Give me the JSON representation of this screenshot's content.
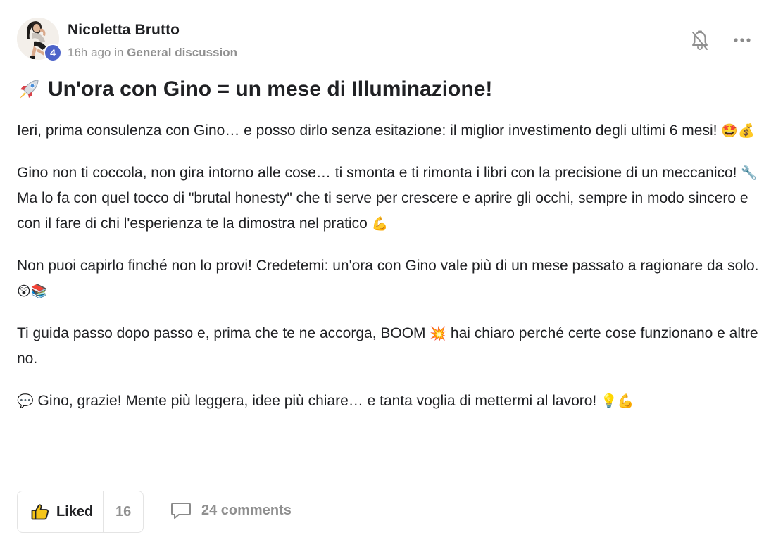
{
  "author": {
    "name": "Nicoletta Brutto",
    "level": "4",
    "time": "16h ago",
    "in_label": "in",
    "category": "General discussion"
  },
  "post": {
    "title_emoji": "rocket",
    "title": "Un'ora con Gino = un mese di Illuminazione!",
    "paragraphs": [
      {
        "text": "Ieri, prima consulenza con Gino… e posso dirlo senza esitazione: il miglior investimento degli ultimi 6 mesi!",
        "emoji": "🤩💰"
      },
      {
        "text": "Gino non ti coccola, non gira intorno alle cose… ti smonta e ti rimonta i libri con la precisione di un meccanico!",
        "emoji": "🔧"
      },
      {
        "text": "Ma lo fa con quel tocco di \"brutal honesty\" che ti serve per crescere e aprire gli occhi, sempre in modo sincero e con il fare di chi l'esperienza te la dimostra nel pratico",
        "emoji": "💪"
      },
      {
        "text": "Non puoi capirlo finché non lo provi! Credetemi: un'ora con Gino vale più di un mese passato a ragionare da solo.",
        "emoji": "😲📚"
      },
      {
        "text_before": "Ti guida passo dopo passo e, prima che te ne accorga, BOOM",
        "emoji": "💥",
        "text_after": "hai chiaro perché certe cose funzionano e altre no."
      },
      {
        "emoji_before": "💬",
        "text": "Gino, grazie! Mente più leggera, idee più chiare… e tanta voglia di mettermi al lavoro!",
        "emoji": "💡💪"
      }
    ]
  },
  "actions": {
    "like_label": "Liked",
    "like_count": "16",
    "comments_label": "24 comments"
  },
  "icons": {
    "bell": "bell-off-icon",
    "more": "more-horizontal-icon",
    "like": "thumbs-up-icon",
    "comment": "comment-bubble-icon"
  },
  "colors": {
    "text": "#202124",
    "muted": "#909090",
    "badge": "#4c63c9",
    "border": "#e4e4e4",
    "like_yellow": "#f5c518"
  }
}
